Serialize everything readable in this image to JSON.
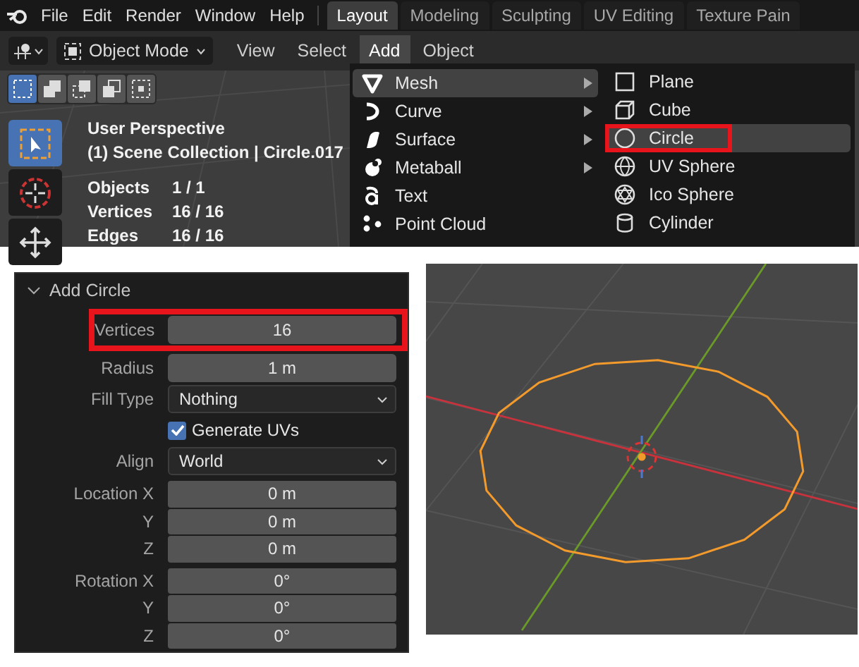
{
  "menubar": {
    "items": [
      "File",
      "Edit",
      "Render",
      "Window",
      "Help"
    ]
  },
  "workspace_tabs": [
    {
      "label": "Layout",
      "selected": true
    },
    {
      "label": "Modeling",
      "selected": false
    },
    {
      "label": "Sculpting",
      "selected": false
    },
    {
      "label": "UV Editing",
      "selected": false
    },
    {
      "label": "Texture Pain",
      "selected": false
    }
  ],
  "header": {
    "mode": "Object Mode",
    "menus": [
      {
        "label": "View",
        "selected": false
      },
      {
        "label": "Select",
        "selected": false
      },
      {
        "label": "Add",
        "selected": true
      },
      {
        "label": "Object",
        "selected": false
      }
    ]
  },
  "select_modes": [
    {
      "kind": "new",
      "selected": true
    },
    {
      "kind": "extend",
      "selected": false
    },
    {
      "kind": "subtract",
      "selected": false
    },
    {
      "kind": "invert",
      "selected": false
    },
    {
      "kind": "intersect",
      "selected": false
    }
  ],
  "tools": [
    {
      "kind": "select-box",
      "selected": true
    },
    {
      "kind": "cursor",
      "selected": false
    },
    {
      "kind": "move",
      "selected": false
    }
  ],
  "viewport_info": {
    "title": "User Perspective",
    "collection": "(1) Scene Collection | Circle.017",
    "stats": [
      {
        "label": "Objects",
        "value": "1 / 1"
      },
      {
        "label": "Vertices",
        "value": "16 / 16"
      },
      {
        "label": "Edges",
        "value": "16 / 16"
      }
    ]
  },
  "add_menu": {
    "items": [
      {
        "kind": "mesh",
        "label": "Mesh",
        "submenu": true,
        "selected": true
      },
      {
        "kind": "curve",
        "label": "Curve",
        "submenu": true,
        "selected": false
      },
      {
        "kind": "surface",
        "label": "Surface",
        "submenu": true,
        "selected": false
      },
      {
        "kind": "metaball",
        "label": "Metaball",
        "submenu": true,
        "selected": false
      },
      {
        "kind": "text",
        "label": "Text",
        "submenu": false,
        "selected": false
      },
      {
        "kind": "pointcloud",
        "label": "Point Cloud",
        "submenu": false,
        "selected": false
      }
    ]
  },
  "mesh_menu": {
    "items": [
      {
        "kind": "plane",
        "label": "Plane",
        "selected": false,
        "annotated": false
      },
      {
        "kind": "cube",
        "label": "Cube",
        "selected": false,
        "annotated": false
      },
      {
        "kind": "circle",
        "label": "Circle",
        "selected": true,
        "annotated": true
      },
      {
        "kind": "uvsphere",
        "label": "UV Sphere",
        "selected": false,
        "annotated": false
      },
      {
        "kind": "icosphere",
        "label": "Ico Sphere",
        "selected": false,
        "annotated": false
      },
      {
        "kind": "cylinder",
        "label": "Cylinder",
        "selected": false,
        "annotated": false
      }
    ]
  },
  "operator_panel": {
    "title": "Add Circle",
    "expanded": true,
    "rows": [
      {
        "kind": "number",
        "label": "Vertices",
        "value": "16",
        "annotated": true
      },
      {
        "kind": "number",
        "label": "Radius",
        "value": "1 m",
        "annotated": false
      },
      {
        "kind": "dropdown",
        "label": "Fill Type",
        "value": "Nothing",
        "annotated": false
      },
      {
        "kind": "checkbox",
        "label": "Generate UVs",
        "checked": true,
        "annotated": false
      },
      {
        "kind": "dropdown",
        "label": "Align",
        "value": "World",
        "annotated": false
      },
      {
        "kind": "vector",
        "annotated": false,
        "components": [
          {
            "label": "Location X",
            "value": "0 m"
          },
          {
            "label": "Y",
            "value": "0 m"
          },
          {
            "label": "Z",
            "value": "0 m"
          }
        ]
      },
      {
        "kind": "vector",
        "annotated": false,
        "components": [
          {
            "label": "Rotation X",
            "value": "0°"
          },
          {
            "label": "Y",
            "value": "0°"
          },
          {
            "label": "Z",
            "value": "0°"
          }
        ]
      }
    ]
  }
}
